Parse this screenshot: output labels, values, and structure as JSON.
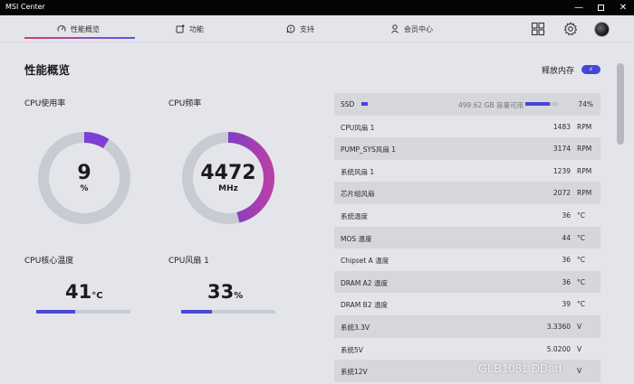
{
  "window": {
    "title": "MSI Center",
    "min_glyph": "—",
    "close_glyph": "✕"
  },
  "tabs": [
    {
      "label": "性能概览",
      "icon": "gauge-icon",
      "active": true
    },
    {
      "label": "功能",
      "icon": "feature-icon"
    },
    {
      "label": "支持",
      "icon": "support-icon"
    },
    {
      "label": "会员中心",
      "icon": "user-icon"
    }
  ],
  "toolbar": {
    "grid_icon": "grid-icon",
    "settings_icon": "gear-icon",
    "avatar_icon": "avatar"
  },
  "page": {
    "title": "性能概览"
  },
  "release_memory": {
    "label": "释放内存",
    "toggle_glyph": "⚡"
  },
  "cards": {
    "cpu_usage": {
      "label": "CPU使用率",
      "value": "9",
      "unit": "%",
      "fraction": 0.09
    },
    "cpu_freq": {
      "label": "CPU频率",
      "value": "4472",
      "unit": "MHz",
      "fraction": 0.46
    },
    "cpu_temp": {
      "label": "CPU核心温度",
      "value": "41",
      "unit": "°C",
      "fraction": 0.41
    },
    "cpu_fan": {
      "label": "CPU风扇 1",
      "value": "33",
      "unit": "%",
      "fraction": 0.33
    }
  },
  "ssd": {
    "name": "SSD",
    "capacity": "499.62 GB 容量可用",
    "percent": "74%",
    "fraction": 0.74
  },
  "stats": [
    {
      "name": "CPU风扇 1",
      "value": "1483",
      "unit": "RPM"
    },
    {
      "name": "PUMP_SYS风扇 1",
      "value": "3174",
      "unit": "RPM"
    },
    {
      "name": "系统风扇 1",
      "value": "1239",
      "unit": "RPM"
    },
    {
      "name": "芯片组风扇",
      "value": "2072",
      "unit": "RPM"
    },
    {
      "name": "系统温度",
      "value": "36",
      "unit": "°C"
    },
    {
      "name": "MOS 温度",
      "value": "44",
      "unit": "°C"
    },
    {
      "name": "Chipset A 温度",
      "value": "36",
      "unit": "°C"
    },
    {
      "name": "DRAM A2 温度",
      "value": "36",
      "unit": "°C"
    },
    {
      "name": "DRAM B2 温度",
      "value": "39",
      "unit": "°C"
    },
    {
      "name": "系统3.3V",
      "value": "3.3360",
      "unit": "V"
    },
    {
      "name": "系统5V",
      "value": "5.0200",
      "unit": "V"
    },
    {
      "name": "系统12V",
      "value": "",
      "unit": "V"
    }
  ],
  "watermark": "GLB1081 DDart",
  "colors": {
    "accent": "#4744d8",
    "gradient_start": "#d93d78",
    "gradient_end": "#4a47e0",
    "track": "#c9cbd2"
  }
}
